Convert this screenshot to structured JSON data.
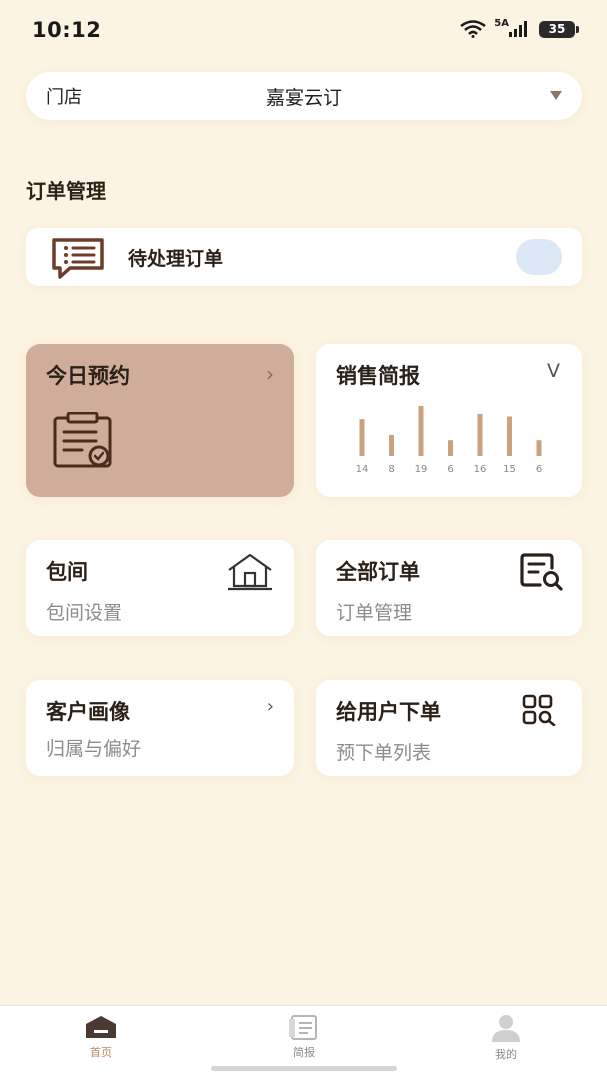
{
  "status": {
    "time": "10:12",
    "network": "5A",
    "battery": "35"
  },
  "store": {
    "label": "门店",
    "value": "嘉宴云订"
  },
  "section": {
    "title": "订单管理"
  },
  "pending": {
    "label": "待处理订单"
  },
  "cards": {
    "today": {
      "title": "今日预约"
    },
    "sales": {
      "title": "销售简报",
      "toggle": "V"
    },
    "room": {
      "title": "包间",
      "subtitle": "包间设置"
    },
    "all_orders": {
      "title": "全部订单",
      "subtitle": "订单管理"
    },
    "customer": {
      "title": "客户画像",
      "subtitle": "归属与偏好"
    },
    "place_order": {
      "title": "给用户下单",
      "subtitle": "预下单列表"
    }
  },
  "chart_data": {
    "type": "bar",
    "categories": [
      "14",
      "8",
      "19",
      "6",
      "16",
      "15",
      "6"
    ],
    "values": [
      14,
      8,
      19,
      6,
      16,
      15,
      6
    ],
    "bar_color": "#c9a27e"
  },
  "nav": {
    "home": "首页",
    "report": "简报",
    "mine": "我的"
  },
  "colors": {
    "background": "#fcf4e2",
    "accent_card": "#cfad9a",
    "active_nav": "#b8876a"
  }
}
